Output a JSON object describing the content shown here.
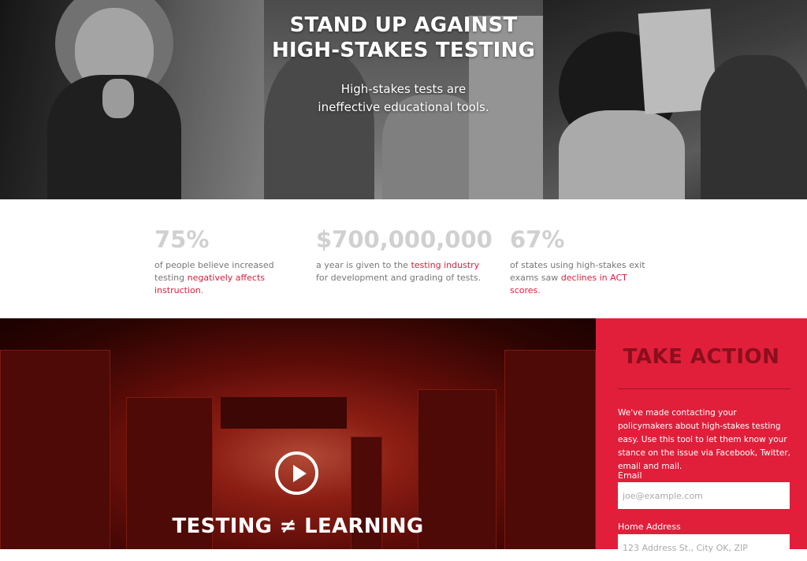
{
  "hero": {
    "title_line1": "STAND UP AGAINST",
    "title_line2": "HIGH-STAKES TESTING",
    "subtitle_line1": "High-stakes tests are",
    "subtitle_line2": "ineffective educational tools."
  },
  "stats": [
    {
      "number": "75%",
      "pre": "of people believe increased testing",
      "link": "negatively affects instruction",
      "post": "."
    },
    {
      "number": "$700,000,000",
      "pre": "a year is given to the",
      "link": "testing industry",
      "post": "for development and grading of tests."
    },
    {
      "number": "67%",
      "pre": "of states using high-stakes exit exams saw",
      "link": "declines in ACT scores",
      "post": "."
    }
  ],
  "video": {
    "title": "TESTING ≠ LEARNING",
    "play_icon": "play-icon"
  },
  "action": {
    "title": "TAKE ACTION",
    "description": "We've made contacting your policymakers about high-stakes testing easy. Use this tool to let them know your stance on the issue via Facebook, Twitter, email and mail.",
    "email_label": "Email",
    "email_placeholder": "joe@example.com",
    "address_label": "Home Address",
    "address_placeholder": "123 Address St., City OK, ZIP"
  },
  "colors": {
    "accent_red": "#e11f3b",
    "dark_red": "#8b0f1d",
    "link_red": "#d81f3b",
    "stat_gray": "#d0d0d0"
  }
}
